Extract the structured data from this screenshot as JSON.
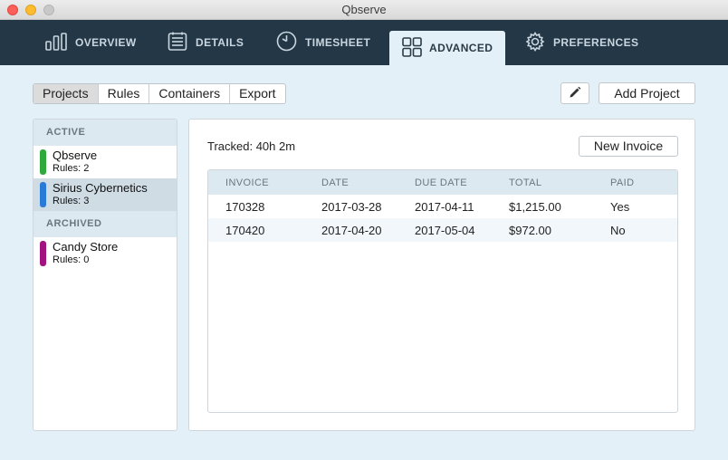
{
  "window": {
    "title": "Qbserve"
  },
  "nav": {
    "tabs": [
      {
        "label": "OVERVIEW",
        "icon": "bar-chart-icon"
      },
      {
        "label": "DETAILS",
        "icon": "list-icon"
      },
      {
        "label": "TIMESHEET",
        "icon": "clock-icon"
      },
      {
        "label": "ADVANCED",
        "icon": "grid-icon",
        "active": true
      },
      {
        "label": "PREFERENCES",
        "icon": "gear-icon"
      }
    ]
  },
  "toolbar": {
    "segments": [
      {
        "label": "Projects",
        "active": true
      },
      {
        "label": "Rules"
      },
      {
        "label": "Containers"
      },
      {
        "label": "Export"
      }
    ],
    "edit_icon": "pencil-icon",
    "add_project_label": "Add Project"
  },
  "sidebar": {
    "active_header": "ACTIVE",
    "active_projects": [
      {
        "name": "Qbserve",
        "rules": "Rules: 2",
        "color": "#2eaa3c"
      },
      {
        "name": "Sirius Cybernetics",
        "rules": "Rules: 3",
        "color": "#2a7ad8",
        "selected": true
      }
    ],
    "archived_header": "ARCHIVED",
    "archived_projects": [
      {
        "name": "Candy Store",
        "rules": "Rules: 0",
        "color": "#a3137f"
      }
    ]
  },
  "main": {
    "tracked": "Tracked: 40h 2m",
    "new_invoice_label": "New Invoice",
    "table": {
      "columns": [
        "INVOICE",
        "DATE",
        "DUE DATE",
        "TOTAL",
        "PAID"
      ],
      "rows": [
        [
          "170328",
          "2017-03-28",
          "2017-04-11",
          "$1,215.00",
          "Yes"
        ],
        [
          "170420",
          "2017-04-20",
          "2017-05-04",
          "$972.00",
          "No"
        ]
      ]
    }
  },
  "colors": {
    "nav_background": "#243746",
    "content_background": "#e3f0f7",
    "header_row": "#dde9f0"
  }
}
